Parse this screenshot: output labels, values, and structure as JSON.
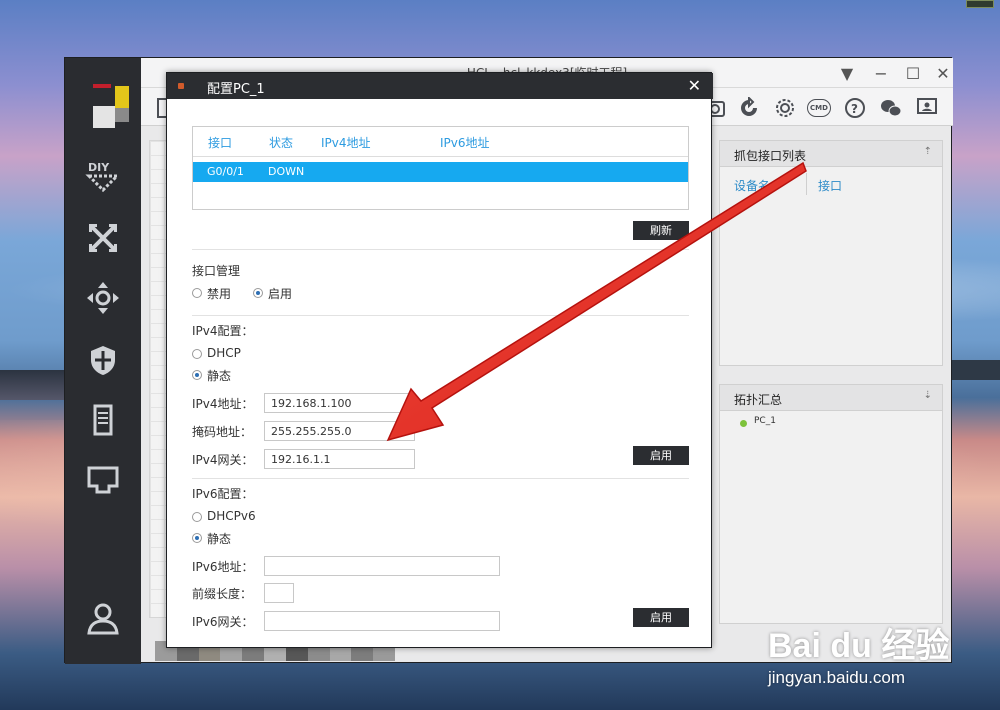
{
  "app": {
    "title": "HCL - hcl_kkdex3[临时工程]",
    "watermark": {
      "main": "Bai du 经验",
      "sub": "jingyan.baidu.com"
    }
  },
  "right_panel": {
    "capture": {
      "title": "抓包接口列表",
      "col_device": "设备名",
      "col_interface": "接口"
    },
    "topology": {
      "title": "拓扑汇总",
      "items": [
        "PC_1"
      ]
    }
  },
  "dialog": {
    "title": "配置PC_1",
    "table": {
      "headers": [
        "接口",
        "状态",
        "IPv4地址",
        "IPv6地址"
      ],
      "rows": [
        {
          "interface": "G0/0/1",
          "status": "DOWN",
          "ipv4": "",
          "ipv6": ""
        }
      ]
    },
    "refresh_label": "刷新",
    "iface_mgmt": {
      "title": "接口管理",
      "disable": "禁用",
      "enable": "启用",
      "selected": "启用"
    },
    "ipv4": {
      "title": "IPv4配置：",
      "dhcp": "DHCP",
      "static": "静态",
      "addr_label": "IPv4地址：",
      "addr_value": "192.168.1.100",
      "mask_label": "掩码地址：",
      "mask_value": "255.255.255.0",
      "gw_label": "IPv4网关：",
      "gw_value": "192.16.1.1",
      "apply": "启用"
    },
    "ipv6": {
      "title": "IPv6配置：",
      "dhcp": "DHCPv6",
      "static": "静态",
      "addr_label": "IPv6地址：",
      "addr_value": "",
      "prefix_label": "前缀长度：",
      "prefix_value": "",
      "gw_label": "IPv6网关：",
      "gw_value": "",
      "apply": "启用"
    }
  },
  "colors": {
    "accent_blue": "#16a9f0",
    "header_blue": "#2d9be0",
    "dark": "#2b2d31",
    "arrow_red": "#e8231f",
    "online_green": "#7dc23b"
  },
  "icons": {
    "sidebar": [
      "diy-icon",
      "shuffle-icon",
      "move-icon",
      "shield-icon",
      "server-icon",
      "port-icon",
      "user-icon"
    ],
    "toolbar": [
      "camera-icon",
      "refresh-icon",
      "gear-icon",
      "cmd-icon",
      "help-icon",
      "wechat-icon",
      "chat-icon"
    ]
  }
}
